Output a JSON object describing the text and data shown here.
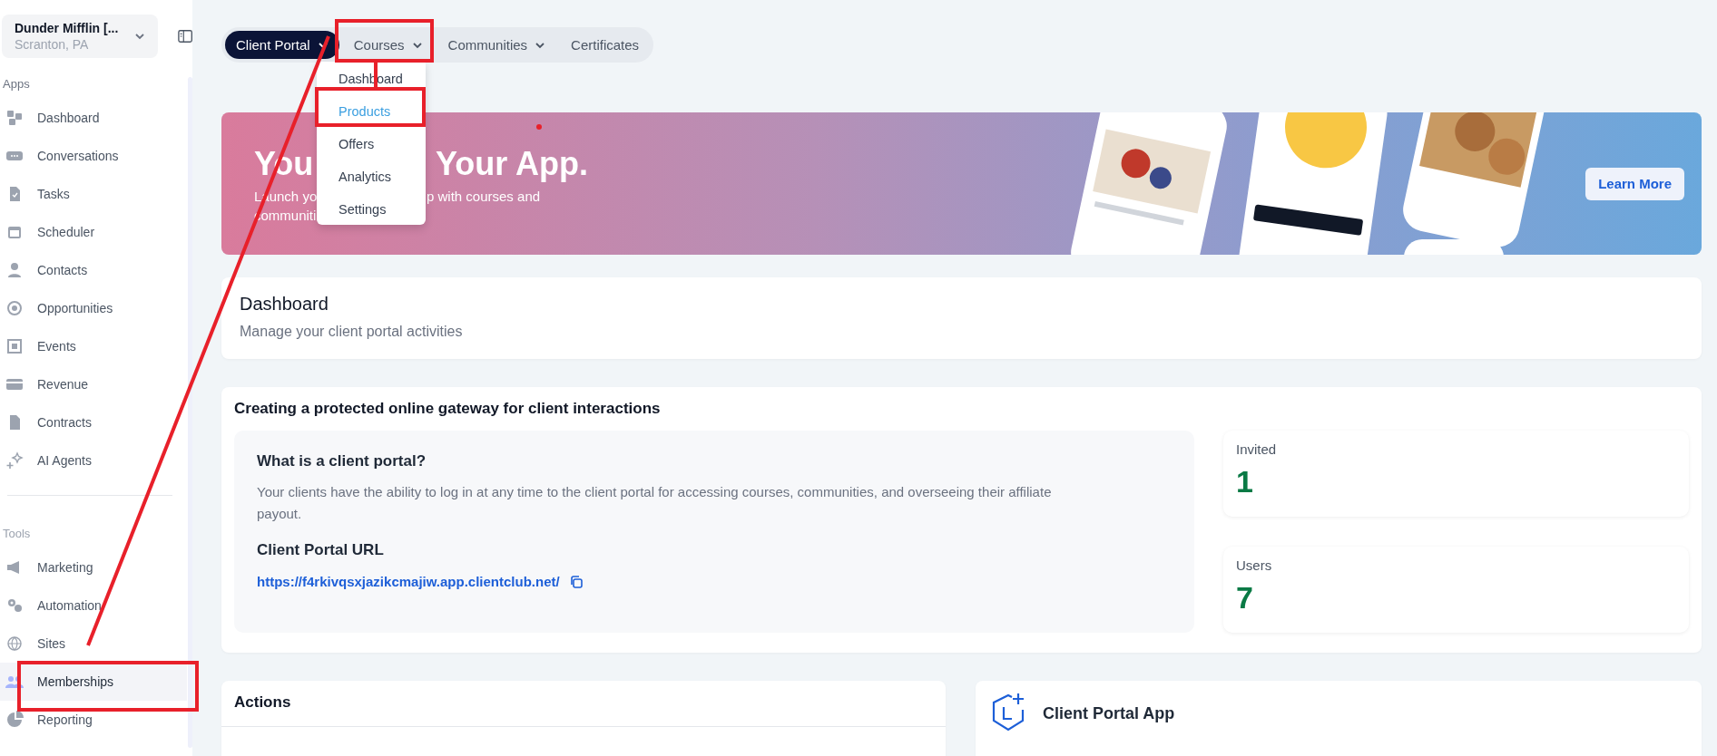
{
  "workspace": {
    "name": "Dunder Mifflin [...",
    "location": "Scranton, PA"
  },
  "sidebar": {
    "sections": [
      {
        "label": "Apps",
        "items": [
          {
            "label": "Dashboard",
            "selected": false
          },
          {
            "label": "Conversations",
            "selected": false
          },
          {
            "label": "Tasks",
            "selected": false
          },
          {
            "label": "Scheduler",
            "selected": false
          },
          {
            "label": "Contacts",
            "selected": false
          },
          {
            "label": "Opportunities",
            "selected": false
          },
          {
            "label": "Events",
            "selected": false
          },
          {
            "label": "Revenue",
            "selected": false
          },
          {
            "label": "Contracts",
            "selected": false
          },
          {
            "label": "AI Agents",
            "selected": false
          }
        ]
      },
      {
        "label": "Tools",
        "items": [
          {
            "label": "Marketing",
            "selected": false
          },
          {
            "label": "Automation",
            "selected": false
          },
          {
            "label": "Sites",
            "selected": false
          },
          {
            "label": "Memberships",
            "selected": true
          },
          {
            "label": "Reporting",
            "selected": false
          }
        ]
      }
    ]
  },
  "tabs": [
    {
      "label": "Client Portal",
      "selected": true,
      "has_menu": true
    },
    {
      "label": "Courses",
      "selected": false,
      "has_menu": true
    },
    {
      "label": "Communities",
      "selected": false,
      "has_menu": true
    },
    {
      "label": "Certificates",
      "selected": false,
      "has_menu": false
    }
  ],
  "dropdown": {
    "items": [
      {
        "label": "Dashboard",
        "selected": false
      },
      {
        "label": "Products",
        "selected": true
      },
      {
        "label": "Offers",
        "selected": false
      },
      {
        "label": "Analytics",
        "selected": false
      },
      {
        "label": "Settings",
        "selected": false
      }
    ]
  },
  "banner": {
    "title_parts": [
      "You",
      "Your App."
    ],
    "subtitle_parts": [
      "Launch yo",
      "p with courses and"
    ],
    "subtitle_line_2": "communiti",
    "button": "Learn More"
  },
  "dashboard": {
    "title": "Dashboard",
    "subtitle": "Manage your client portal activities"
  },
  "gateway": {
    "title": "Creating a protected online gateway for client interactions",
    "question": "What is a client portal?",
    "description": "Your clients have the ability to log in at any time to the client portal for accessing courses, communities, and overseeing their affiliate payout.",
    "url_label": "Client Portal URL",
    "url": "https://f4rkivqsxjazikcmajiw.app.clientclub.net/",
    "stats": [
      {
        "label": "Invited",
        "value": "1"
      },
      {
        "label": "Users",
        "value": "7"
      }
    ]
  },
  "actions": {
    "title": "Actions"
  },
  "app_card": {
    "title": "Client Portal App"
  }
}
